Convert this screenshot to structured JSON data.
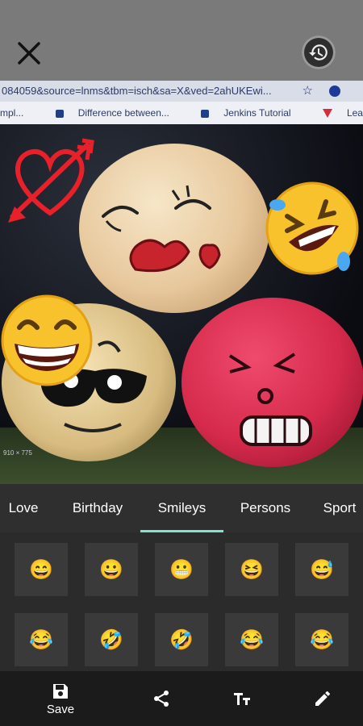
{
  "browser": {
    "url_text": "084059&source=lnms&tbm=isch&sa=X&ved=2ahUKEwi...",
    "bookmarks": [
      "mpl...",
      "Difference between...",
      "Jenkins Tutorial",
      "Learn Web Services..."
    ]
  },
  "photo": {
    "size_label": "910 × 775"
  },
  "stickers": [
    "heart-arrow",
    "rolling-laugh",
    "grinning-face"
  ],
  "tabs": [
    {
      "label": "Love"
    },
    {
      "label": "Birthday"
    },
    {
      "label": "Smileys",
      "selected": true
    },
    {
      "label": "Persons"
    },
    {
      "label": "Sport"
    }
  ],
  "emojis": [
    "😄",
    "😀",
    "😬",
    "😆",
    "😅",
    "😂",
    "🤣",
    "🤣",
    "😂",
    "😂"
  ],
  "toolbar": {
    "save_label": "Save",
    "icons": [
      "save-icon",
      "share-icon",
      "text-size-icon",
      "pencil-icon"
    ]
  },
  "colors": {
    "accent": "#84e0cf",
    "topbar": "#7a7a7a",
    "panel": "#2f2f2f",
    "bottombar": "#1b1b1b"
  }
}
